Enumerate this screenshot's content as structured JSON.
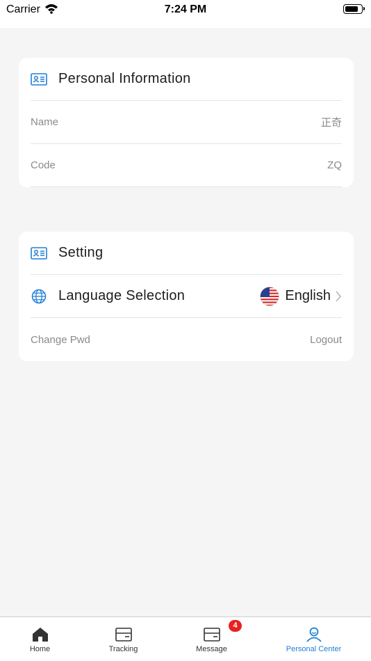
{
  "status_bar": {
    "carrier": "Carrier",
    "time": "7:24 PM"
  },
  "personal_info": {
    "title": "Personal Information",
    "fields": [
      {
        "label": "Name",
        "value": "正奇"
      },
      {
        "label": "Code",
        "value": "ZQ"
      }
    ]
  },
  "setting": {
    "title": "Setting",
    "language_label": "Language Selection",
    "language_value": "English",
    "change_pwd_label": "Change Pwd",
    "logout_label": "Logout"
  },
  "tabbar": {
    "tabs": [
      {
        "label": "Home",
        "icon": "home-icon"
      },
      {
        "label": "Tracking",
        "icon": "package-icon"
      },
      {
        "label": "Message",
        "icon": "message-box-icon"
      },
      {
        "label": "Personal Center",
        "icon": "person-icon"
      }
    ],
    "message_badge": "4",
    "active_color": "#1e7fd6"
  }
}
